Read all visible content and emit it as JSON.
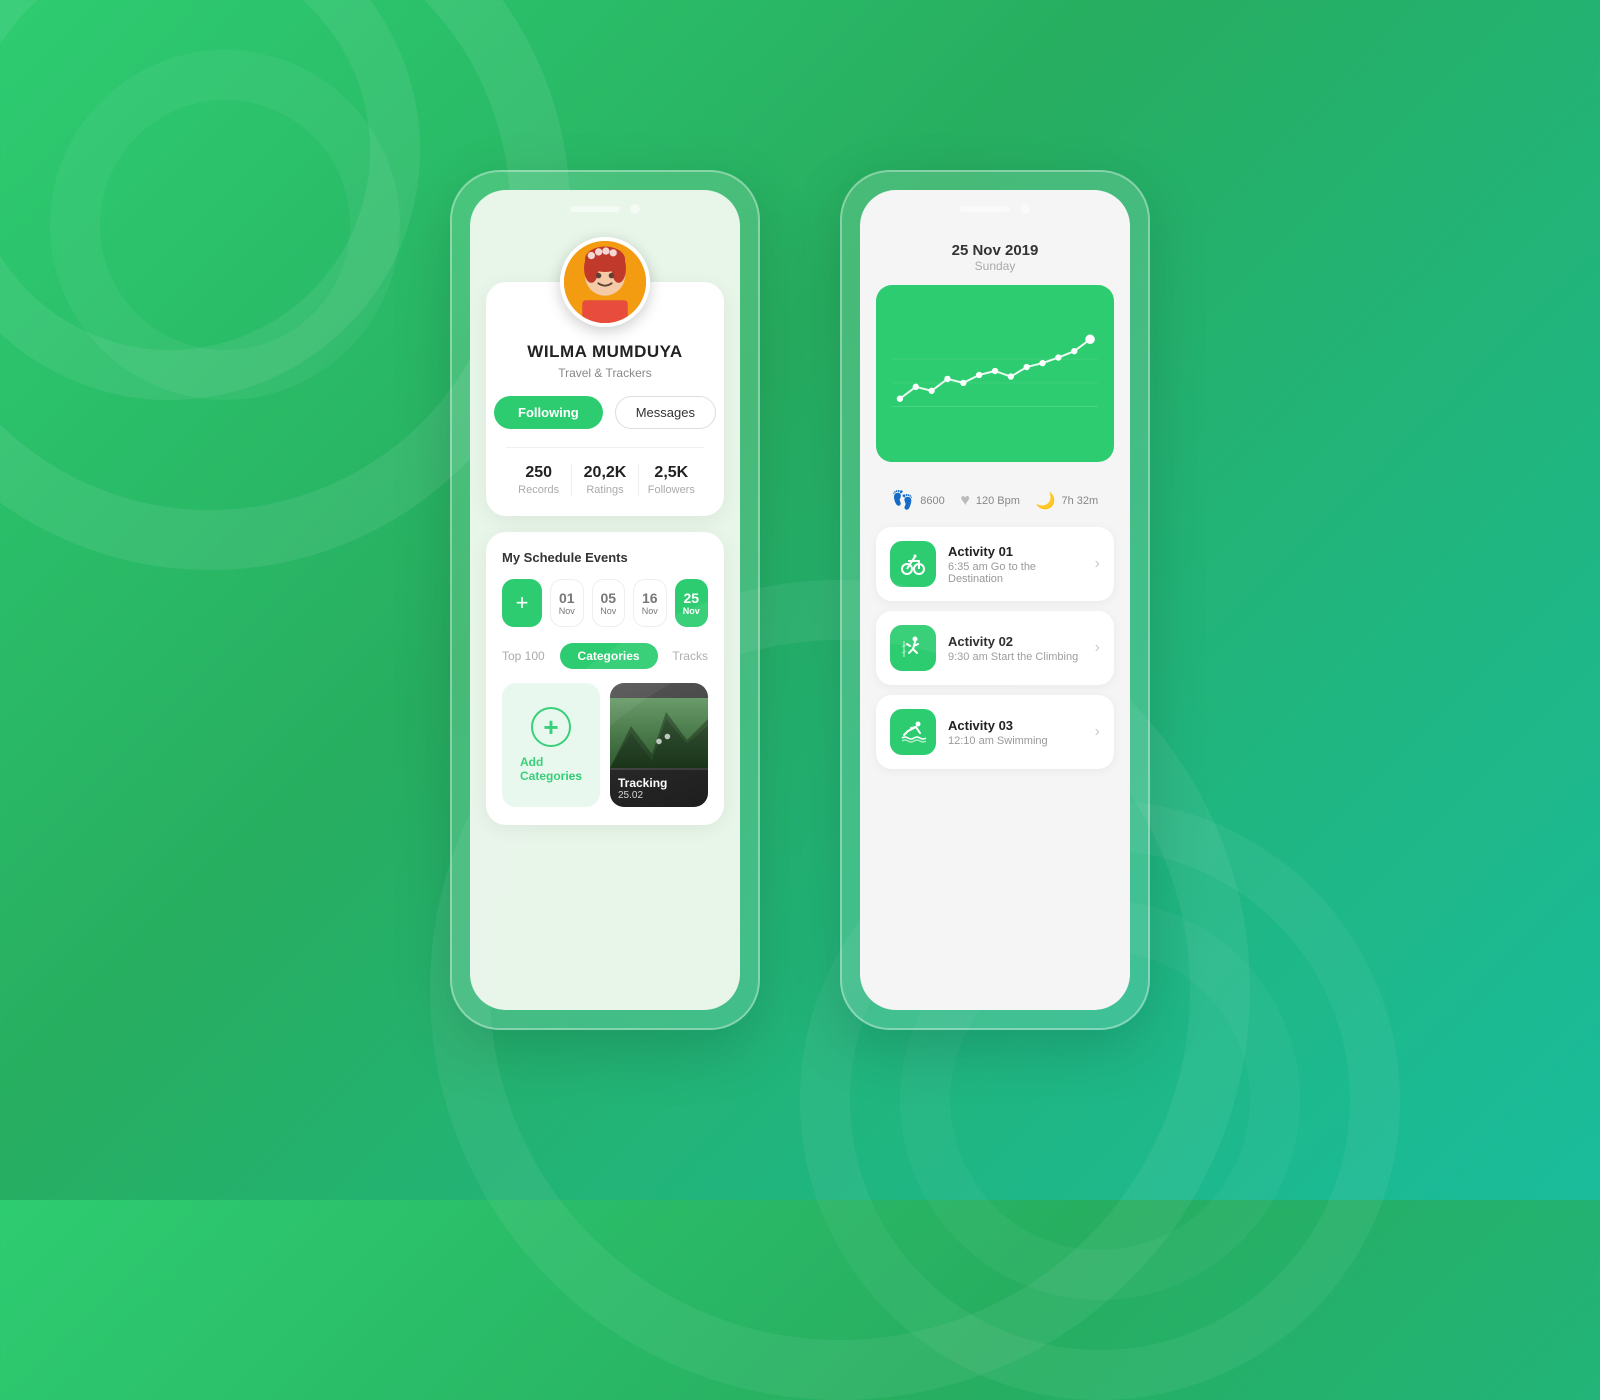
{
  "background": {
    "gradient_start": "#2ecc71",
    "gradient_end": "#1abc9c"
  },
  "phone1": {
    "profile": {
      "name": "WILMA MUMDUYA",
      "subtitle": "Travel & Trackers",
      "btn_following": "Following",
      "btn_messages": "Messages",
      "stats": [
        {
          "value": "250",
          "label": "Records"
        },
        {
          "value": "20,2K",
          "label": "Ratings"
        },
        {
          "value": "2,5K",
          "label": "Followers"
        }
      ]
    },
    "schedule": {
      "title": "My Schedule Events",
      "dates": [
        {
          "num": "01",
          "month": "Nov",
          "active": false
        },
        {
          "num": "05",
          "month": "Nov",
          "active": false
        },
        {
          "num": "16",
          "month": "Nov",
          "active": false
        },
        {
          "num": "25",
          "month": "Nov",
          "active": true
        }
      ],
      "filters": {
        "top100": "Top 100",
        "categories": "Categories",
        "tracks": "Tracks"
      },
      "categories": {
        "add_label": "Add\nCategories",
        "track_label": "Tracking",
        "track_num": "25.02"
      }
    }
  },
  "phone2": {
    "date_header": {
      "big_date": "25 Nov 2019",
      "day_name": "Sunday"
    },
    "stats_bar": [
      {
        "icon": "steps-icon",
        "value": "8600"
      },
      {
        "icon": "heart-icon",
        "value": "120 Bpm"
      },
      {
        "icon": "sleep-icon",
        "value": "7h 32m"
      }
    ],
    "activities": [
      {
        "name": "Activity 01",
        "time": "6:35 am Go to the Destination",
        "icon": "bike-icon"
      },
      {
        "name": "Activity 02",
        "time": "9:30 am Start the Climbing",
        "icon": "climbing-icon"
      },
      {
        "name": "Activity 03",
        "time": "12:10 am Swimming",
        "icon": "swim-icon"
      }
    ]
  }
}
